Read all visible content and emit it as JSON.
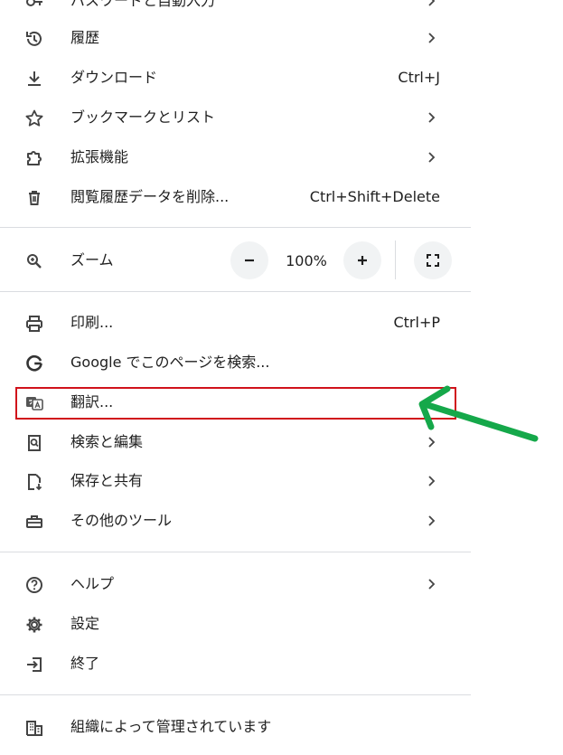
{
  "menu": {
    "top_partial": {
      "label": "パスワードと自動入力"
    },
    "history": {
      "label": "履歴"
    },
    "downloads": {
      "label": "ダウンロード",
      "shortcut": "Ctrl+J"
    },
    "bookmarks": {
      "label": "ブックマークとリスト"
    },
    "extensions": {
      "label": "拡張機能"
    },
    "clear_data": {
      "label": "閲覧履歴データを削除...",
      "shortcut": "Ctrl+Shift+Delete"
    },
    "zoom": {
      "label": "ズーム",
      "value": "100%"
    },
    "print": {
      "label": "印刷...",
      "shortcut": "Ctrl+P"
    },
    "google_search": {
      "label": "Google でこのページを検索..."
    },
    "translate": {
      "label": "翻訳..."
    },
    "find_edit": {
      "label": "検索と編集"
    },
    "save_share": {
      "label": "保存と共有"
    },
    "more_tools": {
      "label": "その他のツール"
    },
    "help": {
      "label": "ヘルプ"
    },
    "settings": {
      "label": "設定"
    },
    "exit": {
      "label": "終了"
    },
    "managed": {
      "label": "組織によって管理されています"
    }
  },
  "colors": {
    "highlight": "#d0121b",
    "arrow": "#15a84a",
    "divider": "#dadce0",
    "button_bg": "#f1f3f4"
  },
  "icons": {
    "history": "history-icon",
    "downloads": "download-icon",
    "bookmarks": "star-icon",
    "extensions": "puzzle-icon",
    "clear_data": "trash-icon",
    "zoom": "zoom-icon",
    "print": "printer-icon",
    "google_search": "google-icon",
    "translate": "translate-icon",
    "find_edit": "find-icon",
    "save_share": "save-share-icon",
    "more_tools": "toolbox-icon",
    "help": "help-icon",
    "settings": "gear-icon",
    "exit": "exit-icon",
    "managed": "building-icon"
  }
}
